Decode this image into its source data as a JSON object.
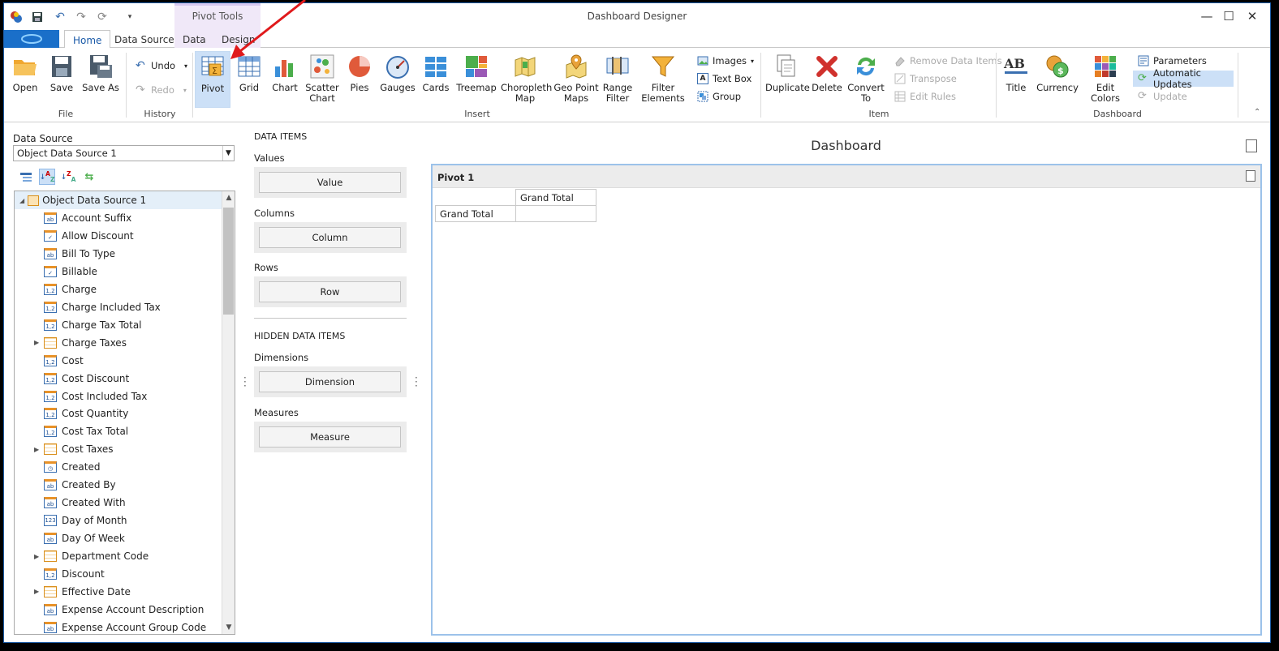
{
  "window": {
    "title": "Dashboard Designer",
    "context_tab_group": "Pivot Tools",
    "controls": [
      "minimize",
      "maximize",
      "close"
    ]
  },
  "tabs": [
    {
      "label": "Home",
      "active": true
    },
    {
      "label": "Data Source",
      "active": false
    },
    {
      "label": "Data",
      "active": false,
      "contextual": true
    },
    {
      "label": "Design",
      "active": false,
      "contextual": true
    }
  ],
  "ribbon": {
    "file": {
      "label": "File",
      "open": "Open",
      "save": "Save",
      "save_as": "Save As"
    },
    "history": {
      "label": "History",
      "undo": "Undo",
      "redo": "Redo"
    },
    "insert": {
      "label": "Insert",
      "pivot": "Pivot",
      "grid": "Grid",
      "chart": "Chart",
      "scatter_chart": "Scatter Chart",
      "pies": "Pies",
      "gauges": "Gauges",
      "cards": "Cards",
      "treemap": "Treemap",
      "choropleth_map": "Choropleth Map",
      "geo_point_maps": "Geo Point Maps",
      "range_filter": "Range Filter",
      "filter_elements": "Filter Elements",
      "images": "Images",
      "text_box": "Text Box",
      "group": "Group"
    },
    "item": {
      "label": "Item",
      "duplicate": "Duplicate",
      "delete": "Delete",
      "convert_to": "Convert To",
      "remove_data_items": "Remove Data Items",
      "transpose": "Transpose",
      "edit_rules": "Edit Rules"
    },
    "dashboard": {
      "label": "Dashboard",
      "title": "Title",
      "currency": "Currency",
      "edit_colors": "Edit Colors",
      "parameters": "Parameters",
      "automatic_updates": "Automatic Updates",
      "update": "Update"
    }
  },
  "data_source": {
    "label": "Data Source",
    "selected": "Object Data Source 1",
    "root": "Object Data Source 1",
    "fields": [
      {
        "name": "Account Suffix",
        "type": "str",
        "expandable": false
      },
      {
        "name": "Allow Discount",
        "type": "chk",
        "expandable": false
      },
      {
        "name": "Bill To Type",
        "type": "str",
        "expandable": false
      },
      {
        "name": "Billable",
        "type": "chk",
        "expandable": false
      },
      {
        "name": "Charge",
        "type": "num",
        "expandable": false
      },
      {
        "name": "Charge Included Tax",
        "type": "num",
        "expandable": false
      },
      {
        "name": "Charge Tax Total",
        "type": "num",
        "expandable": false
      },
      {
        "name": "Charge Taxes",
        "type": "tbl",
        "expandable": true
      },
      {
        "name": "Cost",
        "type": "num",
        "expandable": false
      },
      {
        "name": "Cost Discount",
        "type": "num",
        "expandable": false
      },
      {
        "name": "Cost Included Tax",
        "type": "num",
        "expandable": false
      },
      {
        "name": "Cost Quantity",
        "type": "num",
        "expandable": false
      },
      {
        "name": "Cost Tax Total",
        "type": "num",
        "expandable": false
      },
      {
        "name": "Cost Taxes",
        "type": "tbl",
        "expandable": true
      },
      {
        "name": "Created",
        "type": "dt",
        "expandable": false
      },
      {
        "name": "Created By",
        "type": "str",
        "expandable": false
      },
      {
        "name": "Created With",
        "type": "str",
        "expandable": false
      },
      {
        "name": "Day of Month",
        "type": "int",
        "expandable": false
      },
      {
        "name": "Day Of Week",
        "type": "str",
        "expandable": false
      },
      {
        "name": "Department Code",
        "type": "tbl",
        "expandable": true
      },
      {
        "name": "Discount",
        "type": "num",
        "expandable": false
      },
      {
        "name": "Effective Date",
        "type": "tbl",
        "expandable": true
      },
      {
        "name": "Expense Account Description",
        "type": "str",
        "expandable": false
      },
      {
        "name": "Expense Account Group Code",
        "type": "str",
        "expandable": false
      }
    ]
  },
  "data_items": {
    "header": "DATA ITEMS",
    "values_label": "Values",
    "values_placeholder": "Value",
    "columns_label": "Columns",
    "columns_placeholder": "Column",
    "rows_label": "Rows",
    "rows_placeholder": "Row",
    "hidden_header": "HIDDEN DATA ITEMS",
    "dimensions_label": "Dimensions",
    "dimensions_placeholder": "Dimension",
    "measures_label": "Measures",
    "measures_placeholder": "Measure"
  },
  "dashboard": {
    "title": "Dashboard",
    "item_title": "Pivot 1",
    "pivot": {
      "column_header": "Grand Total",
      "row_header": "Grand Total"
    }
  }
}
